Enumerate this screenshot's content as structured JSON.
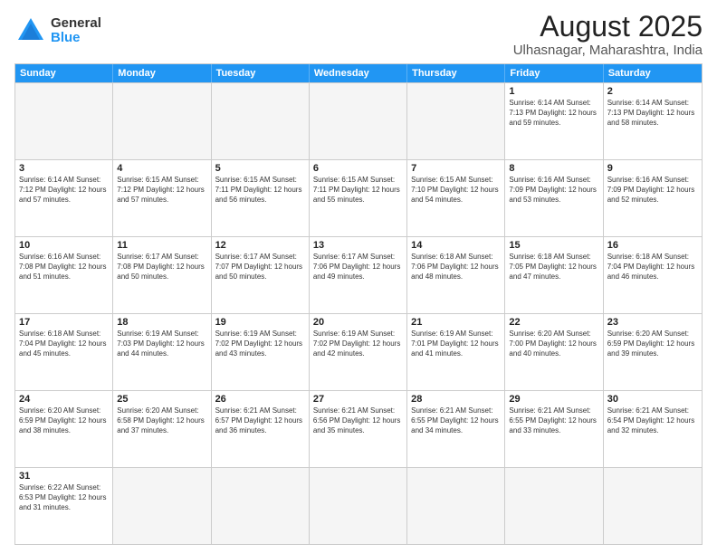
{
  "logo": {
    "general": "General",
    "blue": "Blue"
  },
  "title": "August 2025",
  "subtitle": "Ulhasnagar, Maharashtra, India",
  "header_days": [
    "Sunday",
    "Monday",
    "Tuesday",
    "Wednesday",
    "Thursday",
    "Friday",
    "Saturday"
  ],
  "weeks": [
    [
      {
        "day": "",
        "info": ""
      },
      {
        "day": "",
        "info": ""
      },
      {
        "day": "",
        "info": ""
      },
      {
        "day": "",
        "info": ""
      },
      {
        "day": "",
        "info": ""
      },
      {
        "day": "1",
        "info": "Sunrise: 6:14 AM\nSunset: 7:13 PM\nDaylight: 12 hours and 59 minutes."
      },
      {
        "day": "2",
        "info": "Sunrise: 6:14 AM\nSunset: 7:13 PM\nDaylight: 12 hours and 58 minutes."
      }
    ],
    [
      {
        "day": "3",
        "info": "Sunrise: 6:14 AM\nSunset: 7:12 PM\nDaylight: 12 hours and 57 minutes."
      },
      {
        "day": "4",
        "info": "Sunrise: 6:15 AM\nSunset: 7:12 PM\nDaylight: 12 hours and 57 minutes."
      },
      {
        "day": "5",
        "info": "Sunrise: 6:15 AM\nSunset: 7:11 PM\nDaylight: 12 hours and 56 minutes."
      },
      {
        "day": "6",
        "info": "Sunrise: 6:15 AM\nSunset: 7:11 PM\nDaylight: 12 hours and 55 minutes."
      },
      {
        "day": "7",
        "info": "Sunrise: 6:15 AM\nSunset: 7:10 PM\nDaylight: 12 hours and 54 minutes."
      },
      {
        "day": "8",
        "info": "Sunrise: 6:16 AM\nSunset: 7:09 PM\nDaylight: 12 hours and 53 minutes."
      },
      {
        "day": "9",
        "info": "Sunrise: 6:16 AM\nSunset: 7:09 PM\nDaylight: 12 hours and 52 minutes."
      }
    ],
    [
      {
        "day": "10",
        "info": "Sunrise: 6:16 AM\nSunset: 7:08 PM\nDaylight: 12 hours and 51 minutes."
      },
      {
        "day": "11",
        "info": "Sunrise: 6:17 AM\nSunset: 7:08 PM\nDaylight: 12 hours and 50 minutes."
      },
      {
        "day": "12",
        "info": "Sunrise: 6:17 AM\nSunset: 7:07 PM\nDaylight: 12 hours and 50 minutes."
      },
      {
        "day": "13",
        "info": "Sunrise: 6:17 AM\nSunset: 7:06 PM\nDaylight: 12 hours and 49 minutes."
      },
      {
        "day": "14",
        "info": "Sunrise: 6:18 AM\nSunset: 7:06 PM\nDaylight: 12 hours and 48 minutes."
      },
      {
        "day": "15",
        "info": "Sunrise: 6:18 AM\nSunset: 7:05 PM\nDaylight: 12 hours and 47 minutes."
      },
      {
        "day": "16",
        "info": "Sunrise: 6:18 AM\nSunset: 7:04 PM\nDaylight: 12 hours and 46 minutes."
      }
    ],
    [
      {
        "day": "17",
        "info": "Sunrise: 6:18 AM\nSunset: 7:04 PM\nDaylight: 12 hours and 45 minutes."
      },
      {
        "day": "18",
        "info": "Sunrise: 6:19 AM\nSunset: 7:03 PM\nDaylight: 12 hours and 44 minutes."
      },
      {
        "day": "19",
        "info": "Sunrise: 6:19 AM\nSunset: 7:02 PM\nDaylight: 12 hours and 43 minutes."
      },
      {
        "day": "20",
        "info": "Sunrise: 6:19 AM\nSunset: 7:02 PM\nDaylight: 12 hours and 42 minutes."
      },
      {
        "day": "21",
        "info": "Sunrise: 6:19 AM\nSunset: 7:01 PM\nDaylight: 12 hours and 41 minutes."
      },
      {
        "day": "22",
        "info": "Sunrise: 6:20 AM\nSunset: 7:00 PM\nDaylight: 12 hours and 40 minutes."
      },
      {
        "day": "23",
        "info": "Sunrise: 6:20 AM\nSunset: 6:59 PM\nDaylight: 12 hours and 39 minutes."
      }
    ],
    [
      {
        "day": "24",
        "info": "Sunrise: 6:20 AM\nSunset: 6:59 PM\nDaylight: 12 hours and 38 minutes."
      },
      {
        "day": "25",
        "info": "Sunrise: 6:20 AM\nSunset: 6:58 PM\nDaylight: 12 hours and 37 minutes."
      },
      {
        "day": "26",
        "info": "Sunrise: 6:21 AM\nSunset: 6:57 PM\nDaylight: 12 hours and 36 minutes."
      },
      {
        "day": "27",
        "info": "Sunrise: 6:21 AM\nSunset: 6:56 PM\nDaylight: 12 hours and 35 minutes."
      },
      {
        "day": "28",
        "info": "Sunrise: 6:21 AM\nSunset: 6:55 PM\nDaylight: 12 hours and 34 minutes."
      },
      {
        "day": "29",
        "info": "Sunrise: 6:21 AM\nSunset: 6:55 PM\nDaylight: 12 hours and 33 minutes."
      },
      {
        "day": "30",
        "info": "Sunrise: 6:21 AM\nSunset: 6:54 PM\nDaylight: 12 hours and 32 minutes."
      }
    ],
    [
      {
        "day": "31",
        "info": "Sunrise: 6:22 AM\nSunset: 6:53 PM\nDaylight: 12 hours and 31 minutes."
      },
      {
        "day": "",
        "info": ""
      },
      {
        "day": "",
        "info": ""
      },
      {
        "day": "",
        "info": ""
      },
      {
        "day": "",
        "info": ""
      },
      {
        "day": "",
        "info": ""
      },
      {
        "day": "",
        "info": ""
      }
    ]
  ]
}
